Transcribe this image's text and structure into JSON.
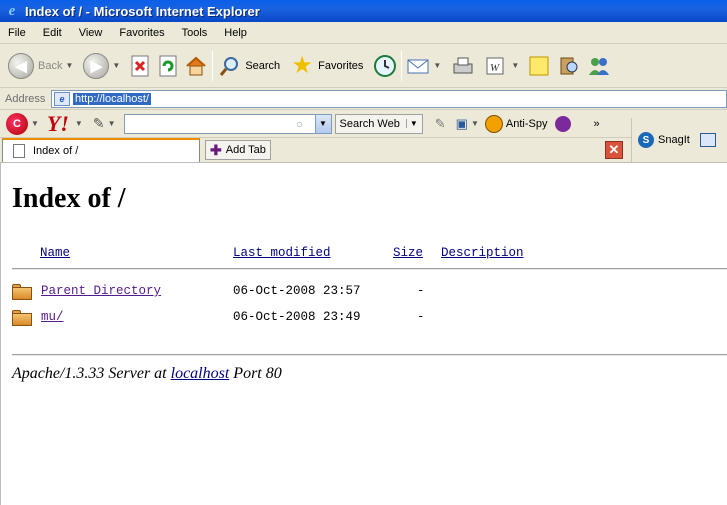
{
  "window": {
    "title": "Index of / - Microsoft Internet Explorer"
  },
  "menu": [
    "File",
    "Edit",
    "View",
    "Favorites",
    "Tools",
    "Help"
  ],
  "toolbar": {
    "back_label": "Back",
    "search_label": "Search",
    "favorites_label": "Favorites"
  },
  "address": {
    "label": "Address",
    "url": "http://localhost/"
  },
  "yahoo_toolbar": {
    "search_web_label": "Search Web",
    "antispy_label": "Anti-Spy",
    "more_label": "»",
    "snagit_label": "SnagIt"
  },
  "tabs": {
    "active_tab_label": "Index of /",
    "add_tab_label": "Add Tab"
  },
  "page": {
    "heading": "Index of /",
    "columns": {
      "name": "Name",
      "modified": "Last modified",
      "size": "Size",
      "description": "Description"
    },
    "rows": [
      {
        "name": "Parent Directory",
        "modified": "06-Oct-2008 23:57",
        "size": "-"
      },
      {
        "name": "mu/",
        "modified": "06-Oct-2008 23:49",
        "size": "-"
      }
    ],
    "footer": {
      "server": "Apache/1.3.33 Server at",
      "host": "localhost",
      "port": "Port 80"
    }
  }
}
